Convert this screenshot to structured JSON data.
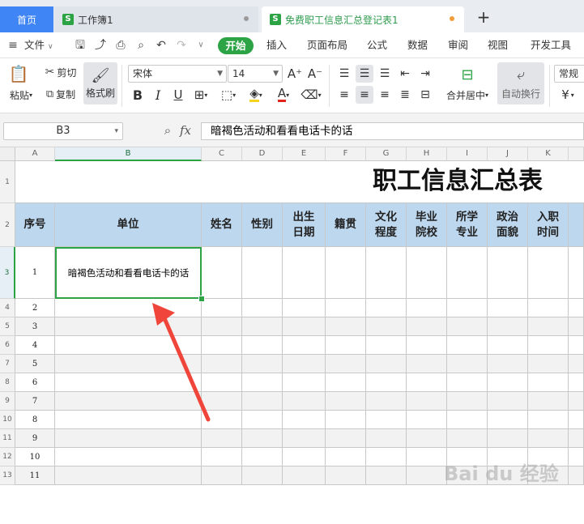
{
  "tabs": {
    "home": "首页",
    "doc1": "工作簿1",
    "doc2": "免费职工信息汇总登记表1",
    "file_icon_letter": "S"
  },
  "menu": {
    "file": "文件",
    "start": "开始",
    "items": [
      "插入",
      "页面布局",
      "公式",
      "数据",
      "审阅",
      "视图",
      "开发工具"
    ]
  },
  "ribbon": {
    "paste": "粘贴",
    "cut": "剪切",
    "copy": "复制",
    "format_painter": "格式刷",
    "font_name": "宋体",
    "font_size": "14",
    "merge_center": "合并居中",
    "auto_wrap": "自动换行",
    "number_format": "常规",
    "currency_symbol": "¥"
  },
  "formula_bar": {
    "cell_ref": "B3",
    "fx_label": "fx",
    "value": "暗褐色活动和看看电话卡的话"
  },
  "grid": {
    "columns": [
      "A",
      "B",
      "C",
      "D",
      "E",
      "F",
      "G",
      "H",
      "I",
      "J",
      "K"
    ],
    "rows": [
      "1",
      "2",
      "3",
      "4",
      "5",
      "6",
      "7",
      "8",
      "9",
      "10",
      "11",
      "12",
      "13"
    ],
    "active_cell": "B3"
  },
  "sheet": {
    "title": "职工信息汇总表",
    "headers": [
      "序号",
      "单位",
      "姓名",
      "性别",
      "出生\n日期",
      "籍贯",
      "文化\n程度",
      "毕业\n院校",
      "所学\n专业",
      "政治\n面貌",
      "入职\n时间"
    ],
    "row_numbers": [
      "1",
      "2",
      "3",
      "4",
      "5",
      "6",
      "7",
      "8",
      "9",
      "10",
      "11",
      "12",
      "13"
    ],
    "b3_value": "暗褐色活动和看看电话卡的话"
  },
  "watermark": "Bai du 经验",
  "colors": {
    "brand_green": "#2ca344",
    "home_tab": "#3f85f6",
    "header_fill": "#bdd7ee",
    "arrow": "#f0453a"
  }
}
